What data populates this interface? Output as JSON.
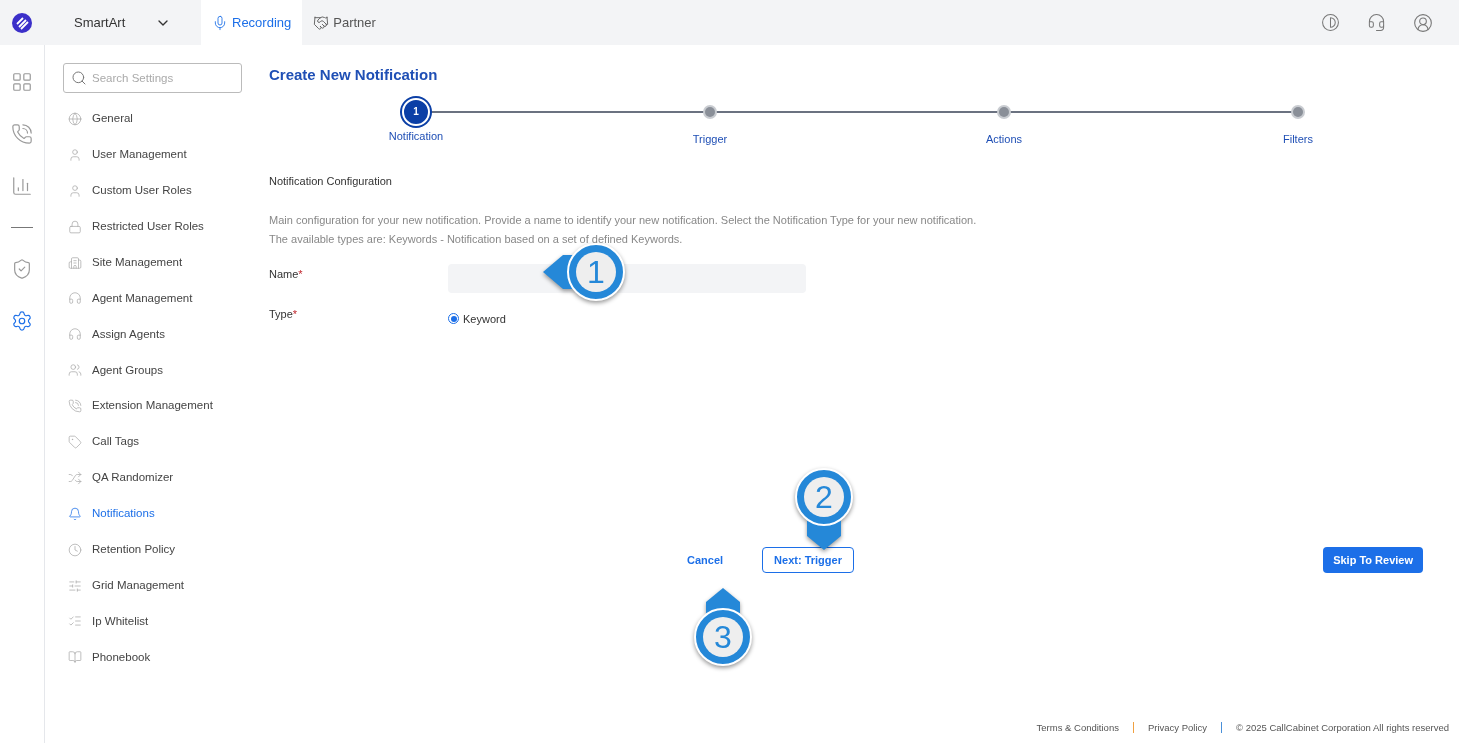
{
  "topbar": {
    "workspace": "SmartArt",
    "tabs": [
      {
        "label": "Recording",
        "selected": true
      },
      {
        "label": "Partner",
        "selected": false
      }
    ]
  },
  "rail": [
    {
      "selected": false
    },
    {
      "selected": false
    },
    {
      "selected": false
    },
    {
      "selected": false
    },
    {
      "selected": true
    }
  ],
  "sidebar": {
    "search": {
      "placeholder": "Search Settings"
    },
    "items": [
      {
        "label": "General",
        "selected": false
      },
      {
        "label": "User Management",
        "selected": false
      },
      {
        "label": "Custom User Roles",
        "selected": false
      },
      {
        "label": "Restricted User Roles",
        "selected": false
      },
      {
        "label": "Site Management",
        "selected": false
      },
      {
        "label": "Agent Management",
        "selected": false
      },
      {
        "label": "Assign Agents",
        "selected": false
      },
      {
        "label": "Agent Groups",
        "selected": false
      },
      {
        "label": "Extension Management",
        "selected": false
      },
      {
        "label": "Call Tags",
        "selected": false
      },
      {
        "label": "QA Randomizer",
        "selected": false
      },
      {
        "label": "Notifications",
        "selected": true
      },
      {
        "label": "Retention Policy",
        "selected": false
      },
      {
        "label": "Grid Management",
        "selected": false
      },
      {
        "label": "Ip Whitelist",
        "selected": false
      },
      {
        "label": "Phonebook",
        "selected": false
      }
    ]
  },
  "main": {
    "title": "Create New Notification",
    "steps": [
      {
        "number": "1",
        "label": "Notification",
        "selected": true
      },
      {
        "label": "Trigger",
        "selected": false
      },
      {
        "label": "Actions",
        "selected": false
      },
      {
        "label": "Filters",
        "selected": false
      }
    ],
    "section_title": "Notification Configuration",
    "description": [
      "Main configuration for your new notification. Provide a name to identify your new notification. Select the Notification Type for your new notification.",
      "The available types are: Keywords - Notification based on a set of defined Keywords."
    ],
    "name_label": "Name",
    "type_label": "Type",
    "required_mark": "*",
    "type_options": [
      {
        "label": "Keyword",
        "selected": true
      }
    ],
    "buttons": {
      "cancel": "Cancel",
      "next": "Next: Trigger",
      "skip": "Skip To Review"
    }
  },
  "callouts": [
    {
      "number": "1"
    },
    {
      "number": "2"
    },
    {
      "number": "3"
    }
  ],
  "footer": {
    "links": [
      "Terms & Conditions",
      "Privacy Policy"
    ],
    "copyright": "© 2025 CallCabinet Corporation All rights reserved"
  }
}
